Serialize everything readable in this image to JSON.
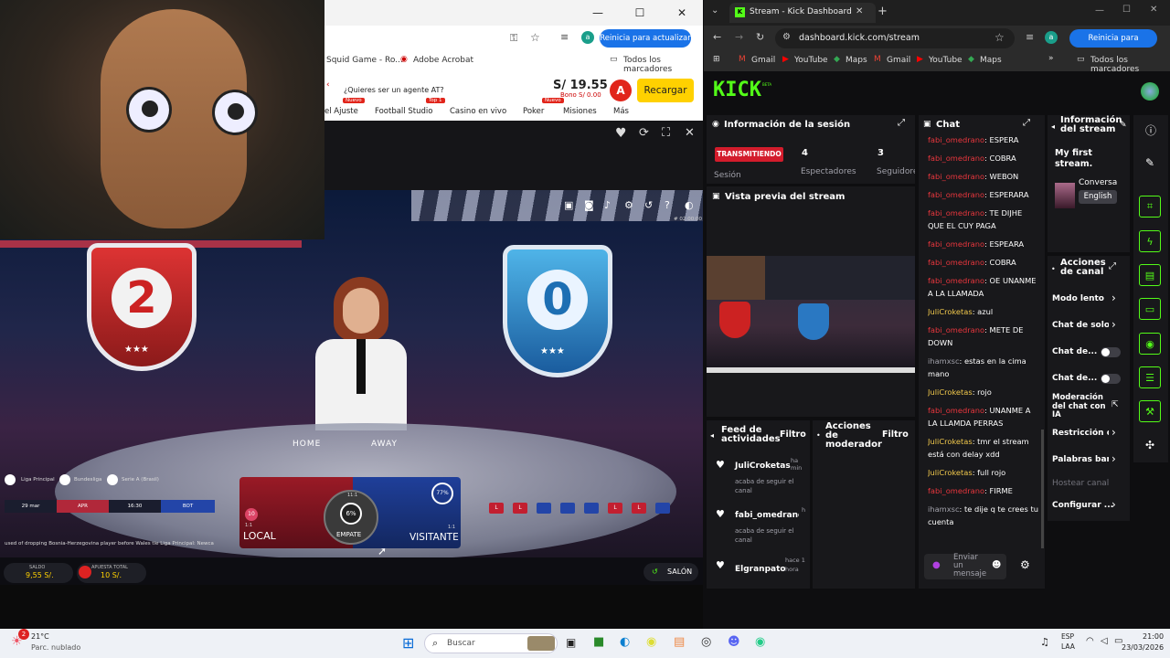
{
  "left_browser": {
    "window_controls": [
      "—",
      "☐",
      "✕"
    ],
    "toolbar_right": "Reinicia para actualizar",
    "bookmarks": [
      "Squid Game - Ro...",
      "Adobe Acrobat",
      "Todos los marcadores"
    ]
  },
  "casino": {
    "promo": "¿Quieres ser un agente AT?",
    "balance": "S/ 19.55",
    "bono": "Bono S/ 0.00",
    "avatar": "A",
    "recargar": "Recargar",
    "nav": [
      {
        "label": "el Ajuste",
        "badge": "Nuevo"
      },
      {
        "label": "Football Studio",
        "badge": "Top 1"
      },
      {
        "label": "Casino en vivo",
        "badge": ""
      },
      {
        "label": "Poker",
        "badge": "Nuevo"
      },
      {
        "label": "Misiones",
        "badge": ""
      },
      {
        "label": "Más",
        "badge": ""
      }
    ]
  },
  "game": {
    "home_score": "2",
    "away_score": "0",
    "table_home": "HOME",
    "table_away": "AWAY",
    "leagues": [
      "Liga Principal",
      "Bundesliga",
      "Serie A (Brasil)"
    ],
    "filter_row": [
      "29 mar",
      "APR",
      "16:30",
      "BOT"
    ],
    "local_label": "LOCAL",
    "visitante_label": "VISITANTE",
    "empate_label": "EMPATE",
    "empate_pct": "6%",
    "local_pct": "10",
    "visitante_pct": "77%",
    "odds_local": "1:1",
    "odds_empate": "11:1",
    "odds_visitante": "1:1",
    "ticker": "used of dropping Bosnia-Herzegovina player before Wales tie   Liga Principal: Newca",
    "saldo_label": "SALDO",
    "saldo_value": "9,55 S/.",
    "apuesta_label": "APUESTA TOTAL",
    "apuesta_value": "10 S/.",
    "salon": "SALÓN",
    "timer": "# 02:00:00",
    "history": [
      "L",
      "L",
      "",
      "",
      "",
      "L",
      "L",
      "",
      ""
    ]
  },
  "right_browser": {
    "tab_title": "Stream - Kick Dashboard",
    "url": "dashboard.kick.com/stream",
    "toolbar_right": "Reinicia para actualizar",
    "bookmarks": [
      "Gmail",
      "YouTube",
      "Maps",
      "Gmail",
      "YouTube",
      "Maps"
    ],
    "bookmarks_all": "Todos los marcadores"
  },
  "kick": {
    "logo": "KICK",
    "beta": "BETA",
    "session": {
      "title": "Información de la sesión",
      "status": "TRANSMITIENDO",
      "status_label": "Sesión",
      "viewers": "4",
      "viewers_label": "Espectadores",
      "followers": "3",
      "followers_label": "Seguidores"
    },
    "preview_title": "Vista previa del stream",
    "feed": {
      "title": "Feed de actividades",
      "filter": "Filtro",
      "items": [
        {
          "user": "JuliCroketas",
          "action": "acaba de seguir el canal",
          "time": "ha min"
        },
        {
          "user": "fabi_omedrano_",
          "action": "acaba de seguir el canal",
          "time": "h"
        },
        {
          "user": "Elgranpato",
          "action": "",
          "time": "hace 1 hora"
        }
      ]
    },
    "mod_actions": {
      "title": "Acciones de moderador",
      "filter": "Filtro"
    },
    "chat": {
      "title": "Chat",
      "messages": [
        {
          "user": "fabi_omedrano",
          "text": "ESPERA"
        },
        {
          "user": "fabi_omedrano",
          "text": "COBRA"
        },
        {
          "user": "fabi_omedrano",
          "text": "WEBON"
        },
        {
          "user": "fabi_omedrano",
          "text": "ESPERARA"
        },
        {
          "user": "fabi_omedrano",
          "text": "TE DIJHE QUE EL CUY PAGA"
        },
        {
          "user": "fabi_omedrano",
          "text": "ESPEARA"
        },
        {
          "user": "fabi_omedrano",
          "text": "COBRA"
        },
        {
          "user": "fabi_omedrano",
          "text": "OE UNANME A LA LLAMADA"
        },
        {
          "user": "JuliCroketas",
          "text": "azul"
        },
        {
          "user": "fabi_omedrano",
          "text": "METE DE DOWN"
        },
        {
          "user": "ihamxsc",
          "text": "estas en la cima mano"
        },
        {
          "user": "JuliCroketas",
          "text": "rojo"
        },
        {
          "user": "fabi_omedrano",
          "text": "UNANME A LA LLAMDA PERRAS"
        },
        {
          "user": "JuliCroketas",
          "text": "tmr el stream está con delay xdd"
        },
        {
          "user": "JuliCroketas",
          "text": "full rojo"
        },
        {
          "user": "fabi_omedrano",
          "text": "FIRME"
        },
        {
          "user": "ihamxsc",
          "text": "te dije q te crees tu cuenta"
        }
      ],
      "input_placeholder": "Enviar un mensaje"
    },
    "stream_info": {
      "title": "Información del stream",
      "stream_title": "My first stream.",
      "category": "Conversa",
      "language": "English"
    },
    "channel_actions": {
      "title": "Acciones de canal",
      "items": [
        {
          "label": "Modo lento",
          "control": "arrow"
        },
        {
          "label": "Chat de solo-",
          "control": "arrow"
        },
        {
          "label": "Chat de...",
          "control": "toggle"
        },
        {
          "label": "Chat de...",
          "control": "toggle"
        },
        {
          "label": "Moderación del chat con IA",
          "control": "external"
        },
        {
          "label": "Restricción de",
          "control": "arrow"
        },
        {
          "label": "Palabras bane",
          "control": "arrow"
        },
        {
          "label": "Hostear canal",
          "control": "disabled"
        },
        {
          "label": "Configurar ...",
          "control": "arrow"
        }
      ]
    }
  },
  "taskbar": {
    "weather_temp": "21°C",
    "weather_desc": "Parc. nublado",
    "search": "Buscar",
    "lang1": "ESP",
    "lang2": "LAA",
    "time": "21:00",
    "date": "23/03/2026",
    "badge": "2"
  }
}
